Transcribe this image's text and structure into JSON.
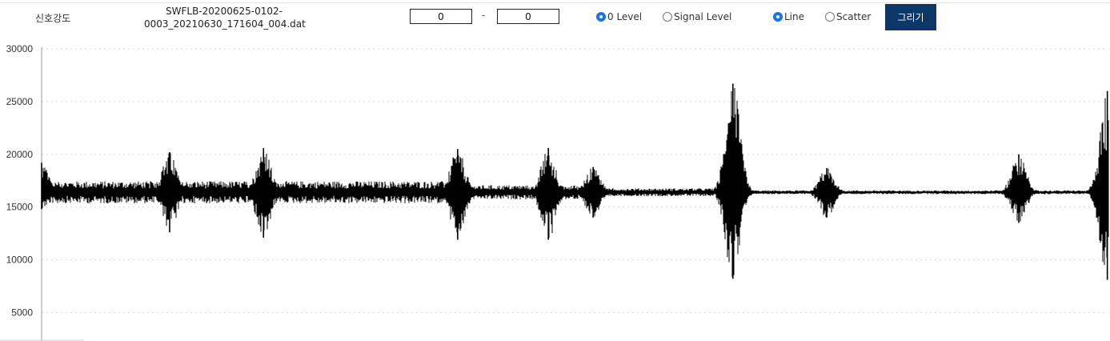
{
  "header": {
    "signal_label": "신호강도",
    "filename_line1": "SWFLB-20200625-0102-",
    "filename_line2": "0003_20210630_171604_004.dat",
    "range_from": "0",
    "range_to": "0",
    "range_separator": "-",
    "level_options": [
      {
        "label": "0 Level",
        "selected": true
      },
      {
        "label": "Signal Level",
        "selected": false
      }
    ],
    "type_options": [
      {
        "label": "Line",
        "selected": true
      },
      {
        "label": "Scatter",
        "selected": false
      }
    ],
    "draw_button": "그리기"
  },
  "colors": {
    "accent": "#1a73e8",
    "button": "#0d3768",
    "trace": "#000000"
  },
  "chart_data": {
    "type": "line",
    "yticks": [
      5000,
      10000,
      15000,
      20000,
      25000,
      30000
    ],
    "ylim": [
      2300,
      30000
    ],
    "grid": true,
    "baseline": 16400,
    "noise_segments": [
      {
        "x_start": 0.0,
        "x_end": 0.4,
        "amp": 700
      },
      {
        "x_start": 0.4,
        "x_end": 0.52,
        "amp": 450
      },
      {
        "x_start": 0.52,
        "x_end": 0.63,
        "amp": 250
      },
      {
        "x_start": 0.63,
        "x_end": 1.0,
        "amp": 120
      }
    ],
    "bursts": [
      {
        "x": 0.0,
        "max": 19200,
        "min": 14800
      },
      {
        "x": 0.12,
        "max": 20200,
        "min": 12600
      },
      {
        "x": 0.208,
        "max": 20600,
        "min": 12100
      },
      {
        "x": 0.39,
        "max": 20500,
        "min": 11900
      },
      {
        "x": 0.475,
        "max": 20600,
        "min": 11900
      },
      {
        "x": 0.517,
        "max": 18800,
        "min": 14000
      },
      {
        "x": 0.648,
        "max": 26700,
        "min": 8200
      },
      {
        "x": 0.736,
        "max": 18700,
        "min": 14000
      },
      {
        "x": 0.916,
        "max": 20000,
        "min": 13500
      },
      {
        "x": 0.999,
        "max": 26000,
        "min": 8100
      }
    ]
  }
}
